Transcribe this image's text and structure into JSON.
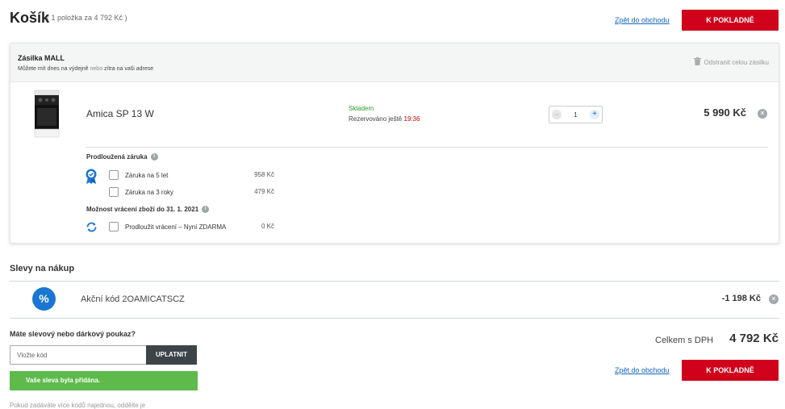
{
  "header": {
    "title": "Košík",
    "subtitle": "( 1 položka za 4 792 Kč )",
    "back_link": "Zpět do obchodu",
    "checkout_btn": "K POKLADNĚ"
  },
  "shipment": {
    "title": "Zásilka MALL",
    "sub_part1": "Můžete mít dnes na výdejně",
    "sub_part2": "nebo",
    "sub_part3": "zítra na vaši adrese",
    "remove_all": "Odstranit celou zásilku"
  },
  "product": {
    "name": "Amica SP 13 W",
    "stock": "Skladem",
    "reserved_label": "Rezervováno ještě",
    "reserved_time": "19:36",
    "qty": "1",
    "qty_minus": "−",
    "qty_plus": "+",
    "price": "5 990 Kč",
    "close": "✕"
  },
  "warranty": {
    "title": "Prodloužená záruka",
    "info": "i",
    "options": [
      {
        "label": "Záruka na 5 let",
        "price": "958 Kč"
      },
      {
        "label": "Záruka na 3 roky",
        "price": "479 Kč"
      }
    ]
  },
  "return": {
    "title": "Možnost vrácení zboží do 31. 1. 2021",
    "info": "i",
    "option_label": "Prodloužit vrácení – Nyní ZDARMA",
    "option_price": "0 Kč"
  },
  "discounts": {
    "title": "Slevy na nákup",
    "badge": "%",
    "code_text": "Akční kód 2OAMICATSCZ",
    "amount": "-1 198 Kč",
    "close": "✕"
  },
  "voucher": {
    "question": "Máte slevový nebo dárkový poukaz?",
    "placeholder": "Vložte kód",
    "apply": "UPLATNIT",
    "success": "Vaše sleva byla přidána.",
    "cut_text": "Pokud zadáváte více kódů najednou, oddělte je"
  },
  "total": {
    "label": "Celkem s DPH",
    "value": "4 792 Kč"
  },
  "colors": {
    "accent_red": "#d0021b",
    "link_blue": "#1565c0",
    "stock_green": "#2e9b2e",
    "success_green": "#5dba4b",
    "badge_blue": "#1976d2"
  }
}
